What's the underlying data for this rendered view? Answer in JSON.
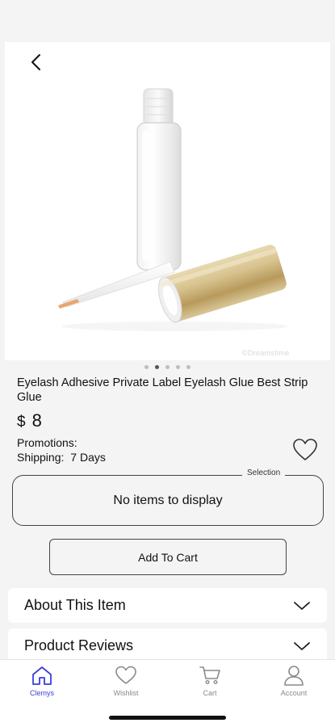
{
  "product": {
    "title": "Eyelash Adhesive Private Label Eyelash Glue Best Strip Glue",
    "currency": "$",
    "price": "8",
    "promotions_label": "Promotions:",
    "shipping_label": "Shipping:",
    "shipping_value": "7 Days",
    "image_watermark": "©Dreamstime",
    "image_index": 2,
    "image_count": 5
  },
  "selection": {
    "legend": "Selection",
    "empty_text": "No items to display"
  },
  "actions": {
    "add_to_cart": "Add To Cart"
  },
  "sections": [
    {
      "label": "About This Item"
    },
    {
      "label": "Product Reviews"
    }
  ],
  "nav": [
    {
      "label": "Clemys",
      "icon": "home-icon",
      "active": true
    },
    {
      "label": "Wishlist",
      "icon": "heart-icon",
      "active": false
    },
    {
      "label": "Cart",
      "icon": "cart-icon",
      "active": false
    },
    {
      "label": "Account",
      "icon": "user-icon",
      "active": false
    }
  ],
  "colors": {
    "accent": "#3b3fd8",
    "inactive": "#8a8a8a",
    "cap_gold": "#c9b07a"
  }
}
